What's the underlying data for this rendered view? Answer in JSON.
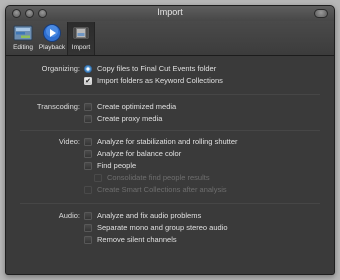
{
  "window": {
    "title": "Import"
  },
  "toolbar": {
    "tabs": [
      {
        "label": "Editing",
        "icon": "editing-icon",
        "active": false
      },
      {
        "label": "Playback",
        "icon": "playback-icon",
        "active": false
      },
      {
        "label": "Import",
        "icon": "import-icon",
        "active": true
      }
    ]
  },
  "organizing": {
    "label": "Organizing:",
    "options": [
      {
        "label": "Copy files to Final Cut Events folder",
        "control": "radio",
        "checked": true,
        "enabled": true
      },
      {
        "label": "Import folders as Keyword Collections",
        "control": "checkbox",
        "checked": true,
        "enabled": true
      }
    ]
  },
  "transcoding": {
    "label": "Transcoding:",
    "options": [
      {
        "label": "Create optimized media",
        "checked": false,
        "enabled": true
      },
      {
        "label": "Create proxy media",
        "checked": false,
        "enabled": true
      }
    ]
  },
  "video": {
    "label": "Video:",
    "options": [
      {
        "label": "Analyze for stabilization and rolling shutter",
        "checked": false,
        "enabled": true
      },
      {
        "label": "Analyze for balance color",
        "checked": false,
        "enabled": true
      },
      {
        "label": "Find people",
        "checked": false,
        "enabled": true
      },
      {
        "label": "Consolidate find people results",
        "checked": false,
        "enabled": false
      },
      {
        "label": "Create Smart Collections after analysis",
        "checked": false,
        "enabled": false
      }
    ]
  },
  "audio": {
    "label": "Audio:",
    "options": [
      {
        "label": "Analyze and fix audio problems",
        "checked": false,
        "enabled": true
      },
      {
        "label": "Separate mono and group stereo audio",
        "checked": false,
        "enabled": true
      },
      {
        "label": "Remove silent channels",
        "checked": false,
        "enabled": true
      }
    ]
  },
  "colors": {
    "background": "#3a3a3a",
    "radio_accent": "#5b9bd5"
  }
}
